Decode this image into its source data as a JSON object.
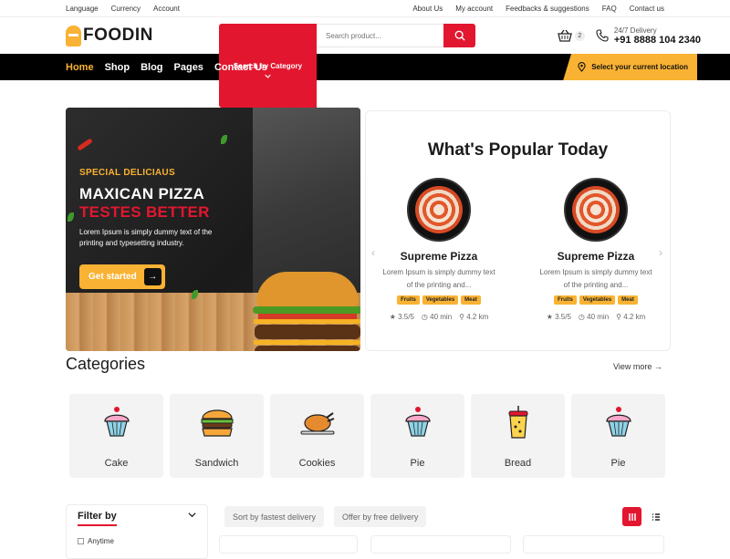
{
  "topbar": {
    "left": [
      "Language",
      "Currency",
      "Account"
    ],
    "right": [
      "About Us",
      "My account",
      "Feedbacks & suggestions",
      "FAQ",
      "Contact us"
    ]
  },
  "header": {
    "logo": "FOODIN",
    "category_label": "Search by Category",
    "search_placeholder": "Search product...",
    "cart_count": "2",
    "delivery_label": "24/7 Delivery",
    "phone": "+91 8888 104 2340"
  },
  "nav": {
    "items": [
      "Home",
      "Shop",
      "Blog",
      "Pages",
      "Contact Us"
    ],
    "location": "Select your current location"
  },
  "hero": {
    "kicker": "SPECIAL DELICIAUS",
    "headline": "MAXICAN PIZZA",
    "headline2": "TESTES BETTER",
    "desc": "Lorem Ipsum is simply dummy text of the printing and typesetting industry.",
    "cta": "Get started"
  },
  "popular": {
    "title": "What's Popular Today",
    "items": [
      {
        "name": "Supreme Pizza",
        "desc": "Lorem Ipsum is simply dummy text of the printing and...",
        "tags": [
          "Fruits",
          "Vegetables",
          "Meat"
        ],
        "rating": "3.5/5",
        "time": "40 min",
        "distance": "4.2 km"
      },
      {
        "name": "Supreme Pizza",
        "desc": "Lorem Ipsum is simply dummy text of the printing and...",
        "tags": [
          "Fruits",
          "Vegetables",
          "Meat"
        ],
        "rating": "3.5/5",
        "time": "40 min",
        "distance": "4.2 km"
      }
    ]
  },
  "categories": {
    "title": "Categories",
    "view_more": "View more",
    "items": [
      {
        "label": "Cake",
        "icon": "cupcake-icon"
      },
      {
        "label": "Sandwich",
        "icon": "burger-icon"
      },
      {
        "label": "Cookies",
        "icon": "roast-chicken-icon"
      },
      {
        "label": "Pie",
        "icon": "cupcake-icon"
      },
      {
        "label": "Bread",
        "icon": "drink-icon"
      },
      {
        "label": "Pie",
        "icon": "cupcake-icon"
      }
    ]
  },
  "filter": {
    "title": "Filter by",
    "option": "Anytime"
  },
  "sort": {
    "fastest": "Sort by fastest delivery",
    "free": "Offer by free delivery"
  },
  "colors": {
    "accent": "#e3162f",
    "secondary": "#f9b233",
    "nav_bg": "#000000"
  }
}
